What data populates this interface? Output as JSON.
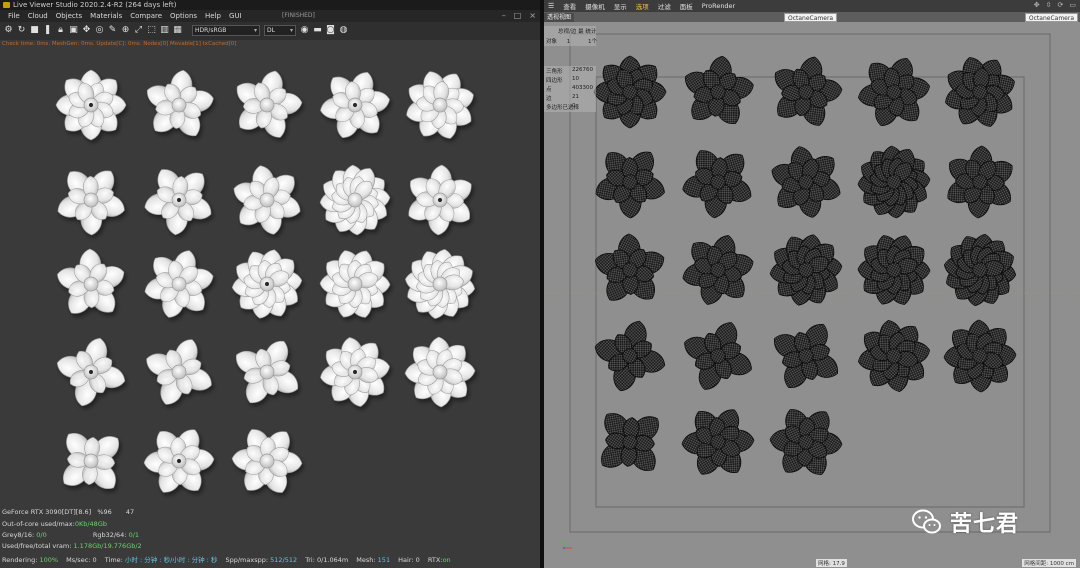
{
  "left": {
    "title": "Live Viewer Studio 2020.2.4-R2 (264 days left)",
    "menu": [
      "File",
      "Cloud",
      "Objects",
      "Materials",
      "Compare",
      "Options",
      "Help",
      "GUI"
    ],
    "finished": "[FINISHED]",
    "toolbar": {
      "color_space": "HDR/sRGB",
      "kernel": "DL"
    },
    "status_line": "Check time: 0ms. MeshGen: 0ms. Update[C]: 0ms. Nodes[0] Movable[1] txCached[0]",
    "info": {
      "gpu": "GeForce RTX 3090[DT][8.6]",
      "gpu_pct": "%96",
      "gpu_temp": "47",
      "out_of_core_label": "Out-of-core used/max:",
      "out_of_core_value": "0Kb/48Gb",
      "grey_label": "Grey8/16: ",
      "grey_value": "0/0",
      "rgb_label": "Rgb32/64: ",
      "rgb_value": "0/1",
      "vram_label": "Used/free/total vram: ",
      "vram_value": "1.178Gb/19.776Gb/2",
      "rendering_label": "Rendering: ",
      "rendering_value": "100%",
      "ms_label": "Ms/sec: 0",
      "time_label": "Time: ",
      "time_value": "小时 : 分钟 : 秒/小时 : 分钟 : 秒",
      "spp_label": "Spp/maxspp: ",
      "spp_value": "512/512",
      "tri_label": "Tri: 0/1.064m",
      "mesh_label": "Mesh: ",
      "mesh_value": "151",
      "hair_label": "Hair: 0",
      "rtx_label": "RTX:",
      "rtx_value": "on"
    }
  },
  "right": {
    "menu": [
      "查看",
      "摄像机",
      "显示",
      "选项",
      "过滤",
      "面板",
      "ProRender"
    ],
    "active_menu_index": 3,
    "tab": "透视视图",
    "camera_center": "OctaneCamera",
    "camera_right": "OctaneCamera",
    "overlay_top": {
      "row1": "总视/边 最 统计",
      "row2_label": "对象",
      "row2_value": "1",
      "row2_right": "1个"
    },
    "overlay_stats": [
      {
        "label": "三角形",
        "value": "226760"
      },
      {
        "label": "四边形",
        "value": "10"
      },
      {
        "label": "点",
        "value": "403300"
      },
      {
        "label": "边",
        "value": "21"
      },
      {
        "label": "多边形已选择",
        "value": "0"
      }
    ],
    "footer_left": "网格: 17.9",
    "footer_right": "网格间距: 1000 cm"
  },
  "watermark": "苦七君",
  "colors": {
    "accent_orange": "#c26a2d",
    "green": "#6fd06f",
    "cyan": "#5fc8e0",
    "active_tab": "#f2c34a"
  }
}
